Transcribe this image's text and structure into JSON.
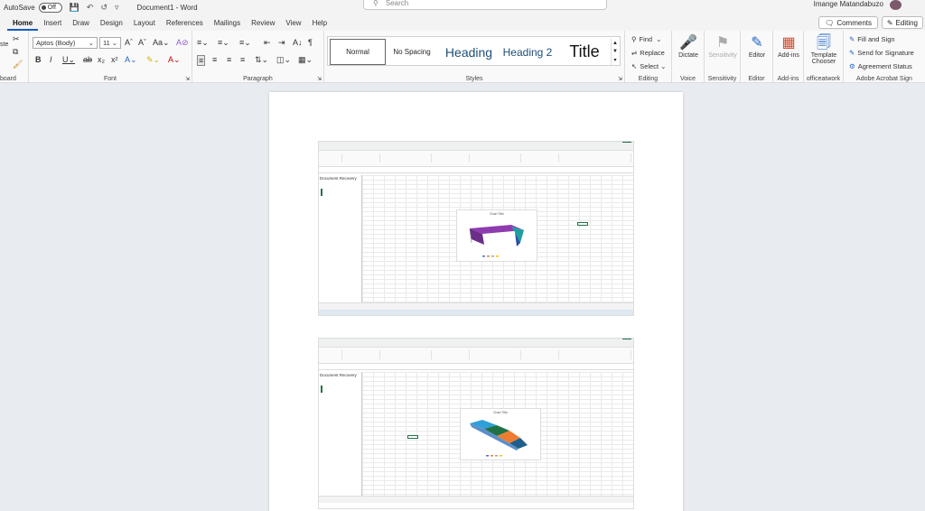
{
  "titlebar": {
    "autosave_label": "AutoSave",
    "autosave_state": "Off",
    "doc_title": "Document1 - Word",
    "search_placeholder": "Search",
    "user_name": "Imange Matandabuzo"
  },
  "tabs": [
    "Home",
    "Insert",
    "Draw",
    "Design",
    "Layout",
    "References",
    "Mailings",
    "Review",
    "View",
    "Help"
  ],
  "active_tab": "Home",
  "right_buttons": {
    "comments": "Comments",
    "editing": "Editing"
  },
  "ribbon": {
    "clipboard": {
      "paste": "ste",
      "label": "board"
    },
    "font": {
      "family": "Aptos (Body)",
      "size": "11",
      "label": "Font"
    },
    "paragraph": {
      "label": "Paragraph"
    },
    "styles": {
      "label": "Styles",
      "items": [
        "Normal",
        "No Spacing",
        "Heading",
        "Heading 2",
        "Title"
      ]
    },
    "editing": {
      "find": "Find",
      "replace": "Replace",
      "select": "Select",
      "label": "Editing"
    },
    "voice": {
      "dictate": "Dictate",
      "label": "Voice"
    },
    "sensitivity": {
      "button": "Sensitivity",
      "label": "Sensitivity"
    },
    "editor": {
      "button": "Editor",
      "label": "Editor"
    },
    "addins": {
      "button": "Add-ins",
      "label": "Add-ins"
    },
    "officeatwork": {
      "button1": "Template",
      "button2": "Chooser",
      "label": "officeatwork"
    },
    "acrobat": {
      "fill": "Fill and Sign",
      "send": "Send for Signature",
      "status": "Agreement Status",
      "label": "Adobe Acrobat Sign"
    }
  },
  "document": {
    "screenshots": [
      {
        "panel_title": "Document Recovery",
        "chart_title": "Chart Title"
      },
      {
        "panel_title": "Document Recovery",
        "chart_title": "Chart Title"
      }
    ]
  },
  "colors": {
    "accent": "#185abd",
    "excel_green": "#217346"
  }
}
